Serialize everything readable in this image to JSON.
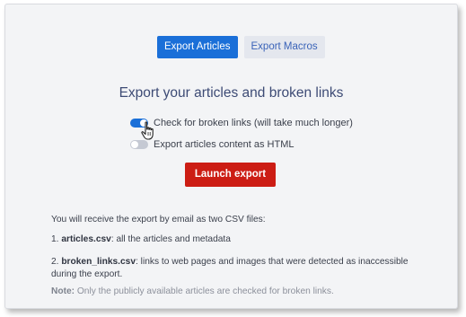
{
  "tabs": [
    {
      "label": "Export Articles",
      "active": true
    },
    {
      "label": "Export Macros",
      "active": false
    }
  ],
  "heading": "Export your articles and broken links",
  "options": [
    {
      "label": "Check for broken links (will take much longer)",
      "enabled": true
    },
    {
      "label": "Export articles content as HTML",
      "enabled": false
    }
  ],
  "launch_button": "Launch export",
  "info": {
    "intro": "You will receive the export by email as two CSV files:",
    "file1_prefix": "1. ",
    "file1_name": "articles.csv",
    "file1_desc": ": all the articles and metadata",
    "file2_prefix": "2. ",
    "file2_name": "broken_links.csv",
    "file2_desc": ": links to web pages and images that were detected as inaccessible during the export.",
    "note_label": "Note:",
    "note_text": " Only the publicly available articles are checked for broken links."
  },
  "colors": {
    "primary": "#1a6fd8",
    "danger": "#cc1d14",
    "heading": "#3d4b75",
    "panel_bg": "#f3f4f6"
  },
  "icons": {
    "cursor": "hand-pointer-icon"
  }
}
